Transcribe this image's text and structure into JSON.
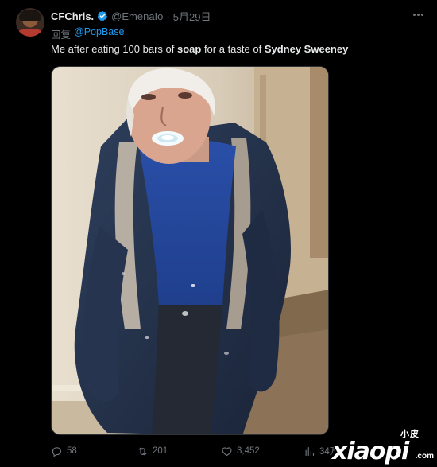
{
  "tweet": {
    "display_name": "CFChris.",
    "handle": "@EmenaIo",
    "separator": "·",
    "date": "5月29日",
    "reply_prefix": "回复",
    "reply_to": "@PopBase",
    "text_parts": [
      {
        "text": "Me after eating 100 bars of ",
        "bold": false
      },
      {
        "text": "soap",
        "bold": true
      },
      {
        "text": " for a taste of ",
        "bold": false
      },
      {
        "text": "Sydney Sweeney",
        "bold": true
      }
    ],
    "media_alt": "photo-elderly-man-soap-mouth"
  },
  "actions": {
    "replies": "58",
    "retweets": "201",
    "likes": "3,452",
    "views": "34万"
  },
  "watermark": {
    "small": "小皮",
    "big": "xiaopi",
    "suffix": ".com"
  },
  "colors": {
    "background": "#000000",
    "text": "#e7e9ea",
    "muted": "#71767b",
    "accent": "#1d9bf0"
  },
  "icons": {
    "verified": "verified-badge-icon",
    "more": "more-dots-icon",
    "reply": "reply-icon",
    "retweet": "retweet-icon",
    "like": "heart-icon",
    "views": "views-icon"
  }
}
